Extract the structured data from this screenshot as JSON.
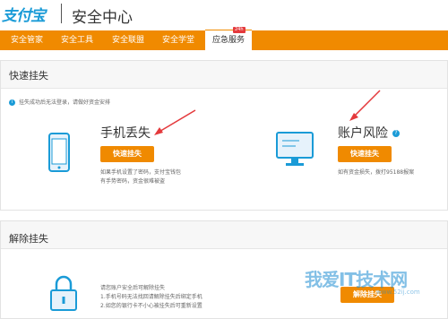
{
  "header": {
    "logo": "支付宝",
    "title": "安全中心"
  },
  "nav": {
    "items": [
      "安全管家",
      "安全工具",
      "安全联盟",
      "安全学堂"
    ],
    "active": "应急服务",
    "badge": "24h"
  },
  "quick": {
    "title": "快速挂失",
    "notice": "挂失成功后无法登录，请做好资金安排",
    "phone": {
      "title": "手机丢失",
      "button": "快速挂失",
      "desc1": "如果手机设置了密码，支付宝钱包",
      "desc2": "有手势密码，资金很难被盗"
    },
    "account": {
      "title": "账户风险",
      "help": "?",
      "button": "快速挂失",
      "desc": "如有资金损失，拨打95188报案"
    }
  },
  "unlock": {
    "title": "解除挂失",
    "line1": "请您账户安全后可解除挂失",
    "line2": "1.手机号码无法找回请解除挂失后绑定手机",
    "line3": "2.如您的银行卡不小心被挂失后可重新设置",
    "button": "解除挂失"
  },
  "watermark": {
    "text": "我爱IT技术网",
    "sub": "www.52ij.com"
  },
  "colors": {
    "accent": "#f08a00",
    "brand": "#1a9bd7",
    "arrow": "#e4393c"
  }
}
